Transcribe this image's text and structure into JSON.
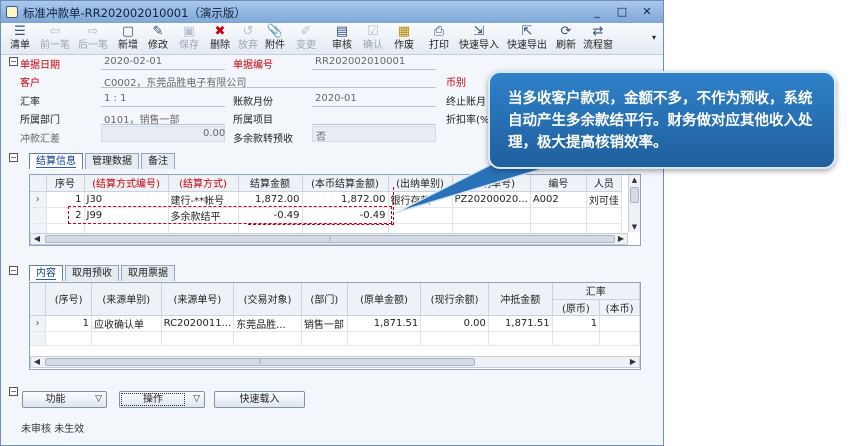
{
  "window": {
    "title": "标准冲款单-RR202002010001（演示版）",
    "controls": {
      "minimize": "_",
      "maximize": "□",
      "close": "✕"
    }
  },
  "toolbar": {
    "items": [
      {
        "label": "清单",
        "icon": "list-icon",
        "enabled": true
      },
      {
        "label": "前一笔",
        "icon": "arrow-left-icon",
        "enabled": false
      },
      {
        "label": "后一笔",
        "icon": "arrow-right-icon",
        "enabled": false
      },
      {
        "label": "新增",
        "icon": "new-doc-icon",
        "enabled": true
      },
      {
        "label": "修改",
        "icon": "edit-icon",
        "enabled": true
      },
      {
        "label": "保存",
        "icon": "save-icon",
        "enabled": false
      },
      {
        "label": "删除",
        "icon": "delete-icon",
        "enabled": true
      },
      {
        "label": "放弃",
        "icon": "discard-icon",
        "enabled": false
      },
      {
        "label": "附件",
        "icon": "attachment-icon",
        "enabled": true
      },
      {
        "label": "变更",
        "icon": "change-icon",
        "enabled": false
      },
      {
        "label": "审核",
        "icon": "audit-icon",
        "enabled": true
      },
      {
        "label": "确认",
        "icon": "confirm-icon",
        "enabled": false
      },
      {
        "label": "作废",
        "icon": "void-icon",
        "enabled": true
      },
      {
        "label": "打印",
        "icon": "print-icon",
        "enabled": true
      },
      {
        "label": "快速导入",
        "icon": "import-icon",
        "enabled": true
      },
      {
        "label": "快速导出",
        "icon": "export-icon",
        "enabled": true
      },
      {
        "label": "刷新",
        "icon": "refresh-icon",
        "enabled": true
      },
      {
        "label": "流程窗",
        "icon": "flow-icon",
        "enabled": true
      }
    ]
  },
  "header": {
    "date_label": "单据日期",
    "date_value": "2020-02-01",
    "no_label": "单据编号",
    "no_value": "RR202002010001",
    "customer_label": "客户",
    "customer_value": "C0002，东莞品胜电子有限公司",
    "currency_label": "币别",
    "rate_label": "汇率",
    "rate_value": "1 : 1",
    "period_label": "账款月份",
    "period_value": "2020-01",
    "end_period_label": "终止账月",
    "dept_label": "所属部门",
    "dept_value": "0101，销售一部",
    "project_label": "所属项目",
    "discount_label": "折扣率(%)",
    "offset_label": "冲款汇差",
    "offset_value": "0.00",
    "surplus_label": "多余款转预收",
    "surplus_value": "否"
  },
  "settle_tabs": [
    "结算信息",
    "管理数据",
    "备注"
  ],
  "settle_grid": {
    "columns": [
      "序号",
      "(结算方式编号)",
      "(结算方式)",
      "结算金额",
      "(本币结算金额)",
      "(出纳单别)",
      "(出纳单号)",
      "编号",
      "人员"
    ],
    "rows": [
      [
        "1",
        "J30",
        "建行-**帐号",
        "1,872.00",
        "1,872.00",
        "银行存款",
        "PZ20200020...",
        "A002",
        "刘可佳"
      ],
      [
        "2",
        "J99",
        "多余款结平",
        "-0.49",
        "-0.49",
        "",
        "",
        "",
        ""
      ]
    ]
  },
  "detail_tabs": [
    "内容",
    "取用预收",
    "取用票据"
  ],
  "detail_grid": {
    "columns": [
      "(序号)",
      "(来源单别)",
      "(来源单号)",
      "(交易对象)",
      "(部门)",
      "(原单金额)",
      "(现行余额)",
      "冲抵金额",
      "汇率",
      "(原币)",
      "(本币)"
    ],
    "rows": [
      [
        "1",
        "应收确认单",
        "RC2020011...",
        "东莞品胜...",
        "销售一部",
        "1,871.51",
        "0.00",
        "1,871.51",
        "1",
        ""
      ]
    ]
  },
  "buttons": {
    "function": "功能",
    "operate": "操作",
    "quick_load": "快速载入"
  },
  "status": {
    "audit": "未审核",
    "effect": "未生效"
  },
  "callout": {
    "text": "当多收客户款项，金额不多，不作为预收，系统自动产生多余款结平行。财务做对应其他收入处理，极大提高核销效率。"
  }
}
